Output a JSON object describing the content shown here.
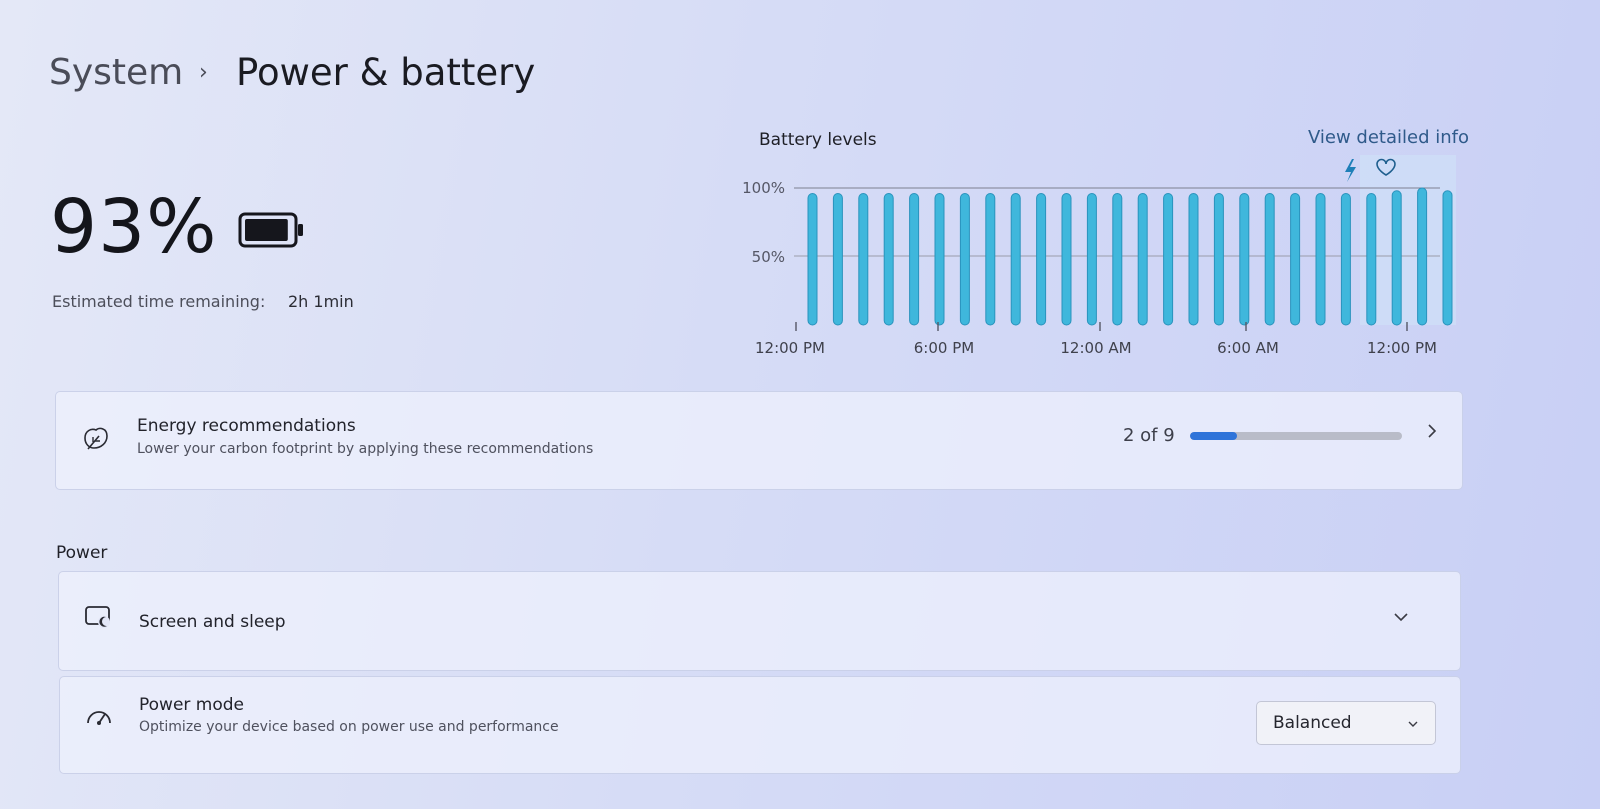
{
  "breadcrumb": {
    "parent": "System",
    "separator": "›",
    "current": "Power & battery"
  },
  "battery": {
    "percent_label": "93%",
    "level": 0.93,
    "estimate_label": "Estimated time remaining:",
    "estimate_value": "2h 1min"
  },
  "chart": {
    "title": "Battery levels",
    "link": "View detailed info",
    "y_ticks": [
      "100%",
      "50%"
    ],
    "x_ticks": [
      "12:00 PM",
      "6:00 PM",
      "12:00 AM",
      "6:00 AM",
      "12:00 PM"
    ],
    "bar_color": "#3fb7dc",
    "charging_icon": "lightning-icon",
    "health_icon": "heart-icon"
  },
  "chart_data": {
    "type": "bar",
    "title": "Battery levels",
    "xlabel": "",
    "ylabel": "",
    "ylim": [
      0,
      100
    ],
    "x_tick_labels": [
      "12:00 PM",
      "6:00 PM",
      "12:00 AM",
      "6:00 AM",
      "12:00 PM"
    ],
    "values": [
      96,
      96,
      96,
      96,
      96,
      96,
      96,
      96,
      96,
      96,
      96,
      96,
      96,
      96,
      96,
      96,
      96,
      96,
      96,
      96,
      96,
      96,
      96,
      98,
      100,
      98
    ]
  },
  "energy": {
    "title": "Energy recommendations",
    "subtitle": "Lower your carbon footprint by applying these recommendations",
    "count_label": "2 of 9",
    "progress": 0.22,
    "icon": "leaf-icon"
  },
  "power_section": {
    "heading": "Power",
    "screen_sleep": {
      "title": "Screen and sleep",
      "icon": "screen-sleep-icon"
    },
    "power_mode": {
      "title": "Power mode",
      "subtitle": "Optimize your device based on power use and performance",
      "value": "Balanced",
      "icon": "gauge-icon"
    }
  },
  "colors": {
    "accent": "#2f74d9",
    "link": "#2f5a8a",
    "bar": "#3fb7dc"
  }
}
